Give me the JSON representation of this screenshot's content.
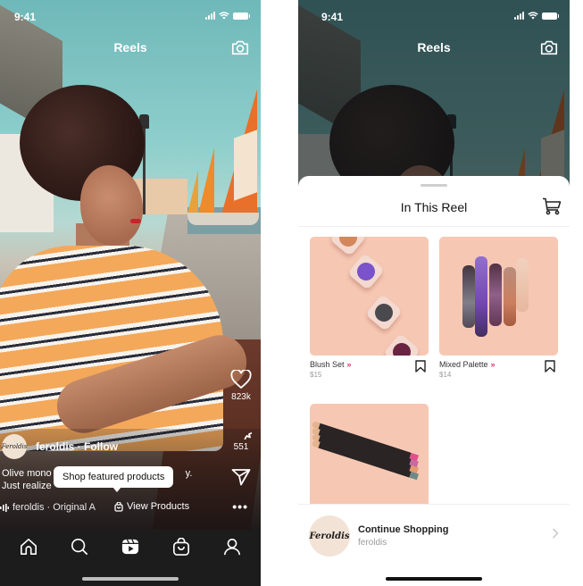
{
  "colors": {
    "accent_chevron": "#d6336c",
    "product_bg": "#f6c8b4",
    "nav_bg": "#1c1c1c"
  },
  "status_bar": {
    "time": "9:41",
    "icons": [
      "signal-icon",
      "wifi-icon",
      "battery-icon"
    ]
  },
  "left_screen": {
    "title": "Reels",
    "camera_icon": "camera-icon",
    "actions": {
      "likes": "823k",
      "comments": "551",
      "like_icon": "heart-icon",
      "comment_icon": "comment-icon",
      "share_icon": "send-icon",
      "more": "•••"
    },
    "author": {
      "avatar_text": "Feroldis",
      "name": "feroldis · Follow"
    },
    "caption": {
      "line1": "Olive mono",
      "line1_end": "y.",
      "line2": "Just realize"
    },
    "tooltip": "Shop featured products",
    "audio": {
      "icon": "audio-wave-icon",
      "text": "feroldis · Original A"
    },
    "view_products": {
      "icon": "shopping-bag-icon",
      "label": "View Products"
    },
    "nav": [
      {
        "name": "home",
        "icon": "home-icon"
      },
      {
        "name": "search",
        "icon": "search-icon"
      },
      {
        "name": "reels",
        "icon": "reels-icon",
        "active": true
      },
      {
        "name": "shop",
        "icon": "shop-bag-icon"
      },
      {
        "name": "profile",
        "icon": "profile-icon"
      }
    ]
  },
  "right_screen": {
    "title": "Reels",
    "sheet": {
      "title": "In This Reel",
      "cart_icon": "cart-icon",
      "products": [
        {
          "name": "Blush Set",
          "price": "$15",
          "chevron": "»"
        },
        {
          "name": "Mixed Palette",
          "price": "$14",
          "chevron": "»"
        },
        {
          "name": "",
          "price": ""
        }
      ],
      "continue": {
        "avatar_text": "Feroldis",
        "title": "Continue Shopping",
        "subtitle": "feroldis"
      }
    }
  }
}
